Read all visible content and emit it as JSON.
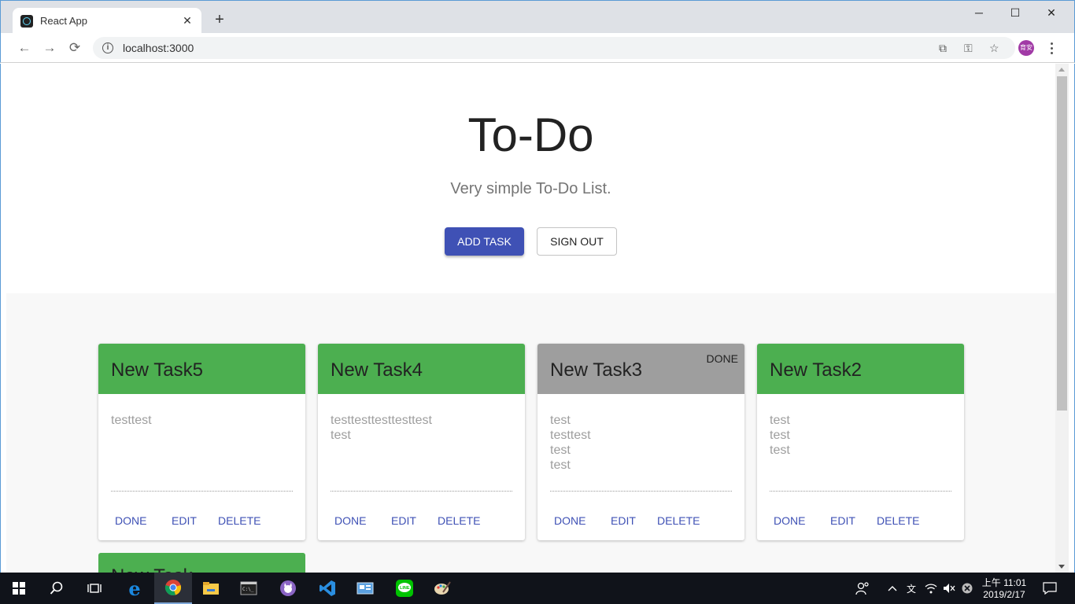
{
  "browser": {
    "tab_title": "React App",
    "url": "localhost:3000",
    "profile_initials": "育安",
    "tab_close": "✕",
    "new_tab": "+",
    "win_minimize": "─",
    "win_maximize": "☐",
    "win_close": "✕"
  },
  "hero": {
    "title": "To-Do",
    "subtitle": "Very simple To-Do List.",
    "add_task_label": "ADD TASK",
    "sign_out_label": "SIGN OUT"
  },
  "cards": [
    {
      "title": "New Task5",
      "status_tag": "",
      "header_color": "#4caf50",
      "lines": [
        "testtest"
      ],
      "done_label": "DONE",
      "edit_label": "EDIT",
      "delete_label": "DELETE"
    },
    {
      "title": "New Task4",
      "status_tag": "",
      "header_color": "#4caf50",
      "lines": [
        "testtesttesttesttest",
        "test"
      ],
      "done_label": "DONE",
      "edit_label": "EDIT",
      "delete_label": "DELETE"
    },
    {
      "title": "New Task3",
      "status_tag": "DONE",
      "header_color": "#9e9e9e",
      "lines": [
        "test",
        "testtest",
        "test",
        "test"
      ],
      "done_label": "DONE",
      "edit_label": "EDIT",
      "delete_label": "DELETE"
    },
    {
      "title": "New Task2",
      "status_tag": "",
      "header_color": "#4caf50",
      "lines": [
        "test",
        "test",
        "test"
      ],
      "done_label": "DONE",
      "edit_label": "EDIT",
      "delete_label": "DELETE"
    }
  ],
  "partial_card": {
    "title": "New Task"
  },
  "taskbar": {
    "time": "上午 11:01",
    "date": "2019/2/17",
    "apps": [
      "start-icon",
      "search-icon",
      "task-view-icon",
      "edge-icon",
      "chrome-icon",
      "file-explorer-icon",
      "terminal-icon",
      "github-desktop-icon",
      "vscode-icon",
      "control-panel-icon",
      "line-icon",
      "paint-icon"
    ]
  },
  "colors": {
    "primary": "#3f51b5",
    "card_active": "#4caf50",
    "card_done": "#9e9e9e"
  }
}
